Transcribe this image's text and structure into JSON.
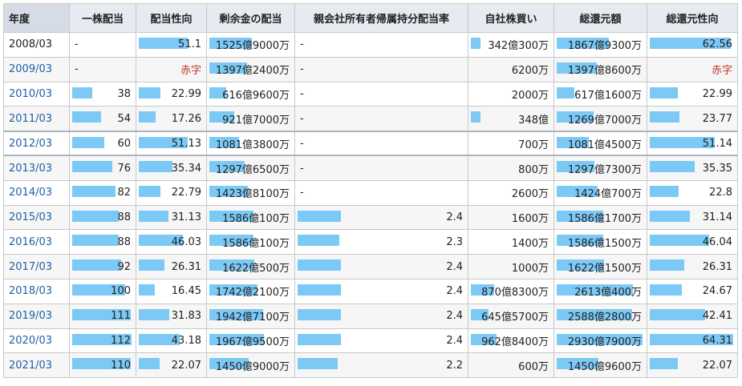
{
  "headers": [
    "年度",
    "一株配当",
    "配当性向",
    "剰余金の配当",
    "親会社所有者帰属持分配当率",
    "自社株買い",
    "総還元額",
    "総還元性向"
  ],
  "colors": {
    "bar": "#7cc9f6",
    "link": "#1f5fa8",
    "negative": "#c0392b",
    "header_bg": "#e6eaf1"
  },
  "rows": [
    {
      "year": "2008/03",
      "link": false,
      "group_start": false,
      "cells": [
        {
          "text": "-",
          "bar": null
        },
        {
          "text": "51.1",
          "bar": 0.77
        },
        {
          "text": "1525億9000万",
          "bar": 0.52
        },
        {
          "text": "-",
          "bar": null
        },
        {
          "text": "342億300万",
          "bar": 0.12
        },
        {
          "text": "1867億9300万",
          "bar": 0.61
        },
        {
          "text": "62.56",
          "bar": 0.97
        }
      ]
    },
    {
      "year": "2009/03",
      "link": true,
      "group_start": false,
      "cells": [
        {
          "text": "-",
          "bar": null
        },
        {
          "text": "赤字",
          "bar": null,
          "red": true
        },
        {
          "text": "1397億2400万",
          "bar": 0.47
        },
        {
          "text": "-",
          "bar": null
        },
        {
          "text": "6200万",
          "bar": null
        },
        {
          "text": "1397億8600万",
          "bar": 0.47
        },
        {
          "text": "赤字",
          "bar": null,
          "red": true
        }
      ]
    },
    {
      "year": "2010/03",
      "link": true,
      "group_start": false,
      "cells": [
        {
          "text": "38",
          "bar": 0.34
        },
        {
          "text": "22.99",
          "bar": 0.34
        },
        {
          "text": "616億9600万",
          "bar": 0.21
        },
        {
          "text": "-",
          "bar": null
        },
        {
          "text": "2000万",
          "bar": null
        },
        {
          "text": "617億1600万",
          "bar": 0.21
        },
        {
          "text": "22.99",
          "bar": 0.34
        }
      ]
    },
    {
      "year": "2011/03",
      "link": true,
      "group_start": false,
      "cells": [
        {
          "text": "54",
          "bar": 0.48
        },
        {
          "text": "17.26",
          "bar": 0.26
        },
        {
          "text": "921億7000万",
          "bar": 0.31
        },
        {
          "text": "-",
          "bar": null
        },
        {
          "text": "348億",
          "bar": 0.12
        },
        {
          "text": "1269億7000万",
          "bar": 0.43
        },
        {
          "text": "23.77",
          "bar": 0.36
        }
      ]
    },
    {
      "year": "2012/03",
      "link": true,
      "group_start": true,
      "cells": [
        {
          "text": "60",
          "bar": 0.54
        },
        {
          "text": "51.13",
          "bar": 0.77
        },
        {
          "text": "1081億3800万",
          "bar": 0.37
        },
        {
          "text": "-",
          "bar": null
        },
        {
          "text": "700万",
          "bar": null
        },
        {
          "text": "1081億4500万",
          "bar": 0.37
        },
        {
          "text": "51.14",
          "bar": 0.78
        }
      ]
    },
    {
      "year": "2013/03",
      "link": true,
      "group_start": true,
      "cells": [
        {
          "text": "76",
          "bar": 0.68
        },
        {
          "text": "35.34",
          "bar": 0.53
        },
        {
          "text": "1297億6500万",
          "bar": 0.44
        },
        {
          "text": "-",
          "bar": null
        },
        {
          "text": "800万",
          "bar": null
        },
        {
          "text": "1297億7300万",
          "bar": 0.44
        },
        {
          "text": "35.35",
          "bar": 0.54
        }
      ]
    },
    {
      "year": "2014/03",
      "link": true,
      "group_start": false,
      "cells": [
        {
          "text": "82",
          "bar": 0.73
        },
        {
          "text": "22.79",
          "bar": 0.34
        },
        {
          "text": "1423億8100万",
          "bar": 0.48
        },
        {
          "text": "-",
          "bar": null
        },
        {
          "text": "2600万",
          "bar": null
        },
        {
          "text": "1424億700万",
          "bar": 0.48
        },
        {
          "text": "22.8",
          "bar": 0.35
        }
      ]
    },
    {
      "year": "2015/03",
      "link": true,
      "group_start": false,
      "cells": [
        {
          "text": "88",
          "bar": 0.79
        },
        {
          "text": "31.13",
          "bar": 0.47
        },
        {
          "text": "1586億100万",
          "bar": 0.54
        },
        {
          "text": "2.4",
          "bar": 0.26
        },
        {
          "text": "1600万",
          "bar": null
        },
        {
          "text": "1586億1700万",
          "bar": 0.54
        },
        {
          "text": "31.14",
          "bar": 0.48
        }
      ]
    },
    {
      "year": "2016/03",
      "link": true,
      "group_start": false,
      "cells": [
        {
          "text": "88",
          "bar": 0.79
        },
        {
          "text": "46.03",
          "bar": 0.69
        },
        {
          "text": "1586億100万",
          "bar": 0.54
        },
        {
          "text": "2.3",
          "bar": 0.25
        },
        {
          "text": "1400万",
          "bar": null
        },
        {
          "text": "1586億1500万",
          "bar": 0.54
        },
        {
          "text": "46.04",
          "bar": 0.71
        }
      ]
    },
    {
      "year": "2017/03",
      "link": true,
      "group_start": false,
      "cells": [
        {
          "text": "92",
          "bar": 0.82
        },
        {
          "text": "26.31",
          "bar": 0.4
        },
        {
          "text": "1622億500万",
          "bar": 0.55
        },
        {
          "text": "2.4",
          "bar": 0.26
        },
        {
          "text": "1000万",
          "bar": null
        },
        {
          "text": "1622億1500万",
          "bar": 0.55
        },
        {
          "text": "26.31",
          "bar": 0.41
        }
      ]
    },
    {
      "year": "2018/03",
      "link": true,
      "group_start": false,
      "cells": [
        {
          "text": "100",
          "bar": 0.89
        },
        {
          "text": "16.45",
          "bar": 0.25
        },
        {
          "text": "1742億2100万",
          "bar": 0.59
        },
        {
          "text": "2.4",
          "bar": 0.26
        },
        {
          "text": "870億8300万",
          "bar": 0.3
        },
        {
          "text": "2613億400万",
          "bar": 0.89
        },
        {
          "text": "24.67",
          "bar": 0.38
        }
      ]
    },
    {
      "year": "2019/03",
      "link": true,
      "group_start": false,
      "cells": [
        {
          "text": "111",
          "bar": 0.99
        },
        {
          "text": "31.83",
          "bar": 0.48
        },
        {
          "text": "1942億7100万",
          "bar": 0.66
        },
        {
          "text": "2.4",
          "bar": 0.26
        },
        {
          "text": "645億5700万",
          "bar": 0.22
        },
        {
          "text": "2588億2800万",
          "bar": 0.88
        },
        {
          "text": "42.41",
          "bar": 0.66
        }
      ]
    },
    {
      "year": "2020/03",
      "link": true,
      "group_start": false,
      "cells": [
        {
          "text": "112",
          "bar": 1.0
        },
        {
          "text": "43.18",
          "bar": 0.65
        },
        {
          "text": "1967億9500万",
          "bar": 0.67
        },
        {
          "text": "2.4",
          "bar": 0.26
        },
        {
          "text": "962億8400万",
          "bar": 0.33
        },
        {
          "text": "2930億7900万",
          "bar": 1.0
        },
        {
          "text": "64.31",
          "bar": 1.0
        }
      ]
    },
    {
      "year": "2021/03",
      "link": true,
      "group_start": false,
      "cells": [
        {
          "text": "110",
          "bar": 0.98
        },
        {
          "text": "22.07",
          "bar": 0.33
        },
        {
          "text": "1450億9000万",
          "bar": 0.49
        },
        {
          "text": "2.2",
          "bar": 0.24
        },
        {
          "text": "600万",
          "bar": null
        },
        {
          "text": "1450億9600万",
          "bar": 0.49
        },
        {
          "text": "22.07",
          "bar": 0.34
        }
      ]
    }
  ]
}
